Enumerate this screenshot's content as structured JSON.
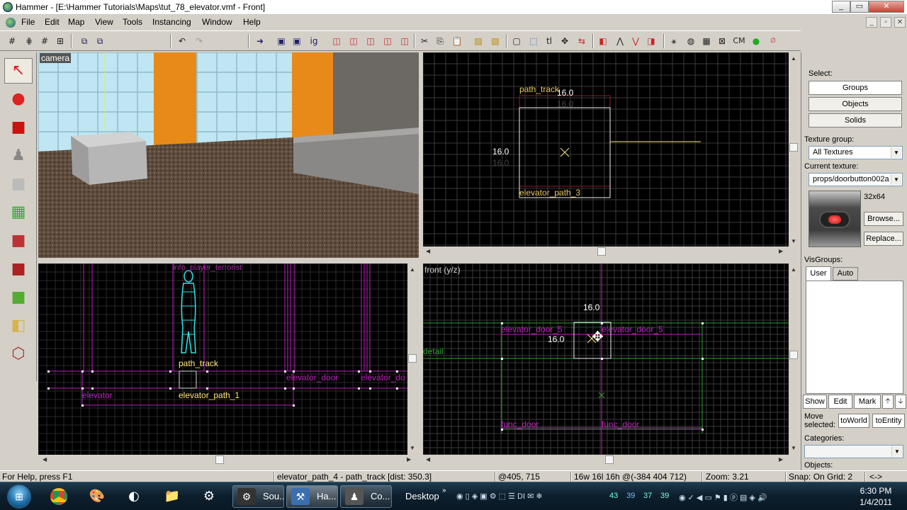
{
  "window": {
    "title": "Hammer - [E:\\Hammer Tutorials\\Maps\\tut_78_elevator.vmf - Front]",
    "controls": [
      "_",
      "▭",
      "✕"
    ],
    "mdi_controls": [
      "_",
      "▫",
      "✕"
    ]
  },
  "menu": [
    "File",
    "Edit",
    "Map",
    "View",
    "Tools",
    "Instancing",
    "Window",
    "Help"
  ],
  "toolbar": {
    "groups": [
      [
        "grid-icon",
        "grid-dots-icon",
        "grid-small-icon"
      ],
      [
        "carve-icon",
        "group-icon"
      ],
      [
        "undo-icon",
        "redo-icon"
      ],
      [
        "run-map-icon"
      ],
      [
        "hide-icon",
        "show-icon",
        "texture-lock-icon"
      ],
      [
        "box-1-icon",
        "box-2-icon",
        "box-3-icon",
        "box-4-icon",
        "box-5-icon"
      ],
      [
        "cut-icon",
        "copy-icon",
        "paste-icon"
      ],
      [
        "hatch-1-icon",
        "hatch-2-icon"
      ],
      [
        "select-box-icon",
        "select-icon",
        "tl-icon",
        "move-icon",
        "arrows-icon"
      ],
      [
        "entity-1-icon",
        "entity-2-icon",
        "entity-3-icon",
        "entity-4-icon"
      ],
      [
        "cordon-icon",
        "sphere-icon",
        "grid-3d-icon",
        "cm-icon",
        "green-icon",
        "no-draw-icon"
      ]
    ],
    "cm_label": "CM"
  },
  "left_tools": [
    {
      "name": "selection-tool",
      "glyph": "↖",
      "color": "#d22"
    },
    {
      "name": "magnify-tool",
      "glyph": "●",
      "color": "#d22"
    },
    {
      "name": "camera-tool",
      "glyph": "■",
      "color": "#c11"
    },
    {
      "name": "entity-tool",
      "glyph": "♟",
      "color": "#888"
    },
    {
      "name": "block-tool",
      "glyph": "■",
      "color": "#bbb"
    },
    {
      "name": "texture-tool",
      "glyph": "▦",
      "color": "#3a3"
    },
    {
      "name": "apply-texture-tool",
      "glyph": "■",
      "color": "#b33"
    },
    {
      "name": "decal-tool",
      "glyph": "■",
      "color": "#a22"
    },
    {
      "name": "overlay-tool",
      "glyph": "■",
      "color": "#5a3"
    },
    {
      "name": "clip-tool",
      "glyph": "◧",
      "color": "#d9b24a"
    },
    {
      "name": "vertex-tool",
      "glyph": "⬡",
      "color": "#a33"
    }
  ],
  "views": {
    "camera": {
      "label": "camera"
    },
    "top_right": {
      "path_track_label": "path_track",
      "dim_top": "16.0",
      "dim_top_faded": "16.0",
      "dim_left": "16.0",
      "dim_left_faded": "16.0",
      "elevator_path_label": "elevator_path_3"
    },
    "side": {
      "spawn_label": "info_player_terrorist",
      "path_track_label": "path_track",
      "elevator_label": "elevator",
      "elevator_path_label": "elevator_path_1",
      "door_label_1": "elevator_door",
      "door_label_2": "elevator_do"
    },
    "front": {
      "label": "front (y/z)",
      "dim_top": "16.0",
      "dim_left": "16.0",
      "door_left": "elevator_door_5",
      "door_right": "elevator_door_5",
      "detail": "detail",
      "func_door_left": "func_door",
      "func_door_right": "func_door"
    }
  },
  "right_panel": {
    "select_label": "Select:",
    "groups_btn": "Groups",
    "objects_btn": "Objects",
    "solids_btn": "Solids",
    "texture_group_label": "Texture group:",
    "texture_group_value": "All Textures",
    "current_texture_label": "Current texture:",
    "current_texture_value": "props/doorbutton002a",
    "texture_size": "32x64",
    "browse_btn": "Browse...",
    "replace_btn": "Replace...",
    "visgroups_label": "VisGroups:",
    "tab_user": "User",
    "tab_auto": "Auto",
    "show_btn": "Show",
    "edit_btn": "Edit",
    "mark_btn": "Mark",
    "up_btn": "🡡",
    "down_btn": "🡣",
    "move_selected_label_1": "Move",
    "move_selected_label_2": "selected:",
    "to_world_btn": "toWorld",
    "to_entity_btn": "toEntity",
    "categories_label": "Categories:",
    "objects_label": "Objects:"
  },
  "status": {
    "help": "For Help, press F1",
    "selection": "elevator_path_4 - path_track  [dist: 350.3]",
    "cursor": "@405, 715",
    "size": "16w 16l 16h @(-384 404 712)",
    "zoom": "Zoom: 3.21",
    "snap": "Snap: On Grid: 2",
    "nav": "<->"
  },
  "taskbar": {
    "pinned": [
      "chrome-icon",
      "paint-icon",
      "media-icon",
      "folder-icon",
      "steam-icon"
    ],
    "tasks": [
      {
        "label": "Sou...",
        "icon": "steam-icon"
      },
      {
        "label": "Ha...",
        "icon": "hammer-icon"
      },
      {
        "label": "Co...",
        "icon": "counter-strike-icon"
      }
    ],
    "desktop": "Desktop",
    "tray_numbers": [
      "43",
      "39",
      "37",
      "39"
    ],
    "time": "6:30 PM",
    "date": "1/4/2011"
  },
  "colors": {
    "magenta": "#c020c0",
    "yellow_label": "#ffe680",
    "cyan": "#27e6e6",
    "grid": "#3a3a3a",
    "green_line": "#2aa02a"
  }
}
